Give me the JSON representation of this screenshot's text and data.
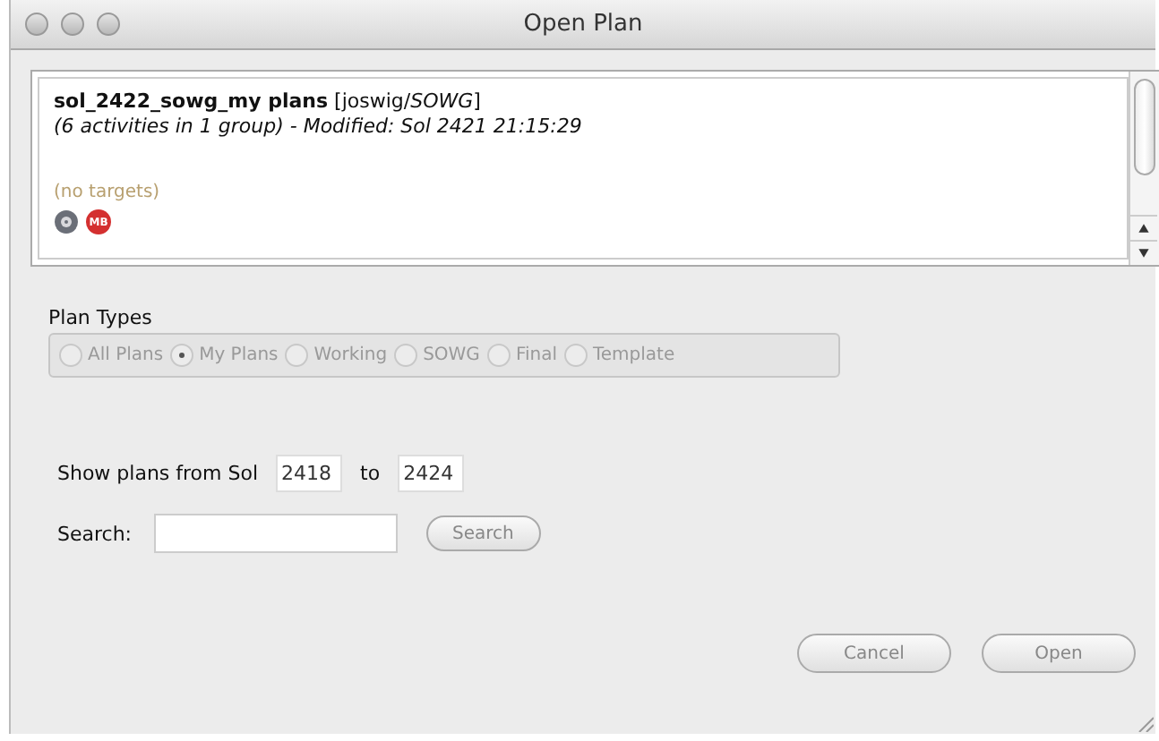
{
  "window": {
    "title": "Open Plan"
  },
  "plans": [
    {
      "name": "sol_2422_sowg_my plans",
      "owner": "[joswig/*SOWG*]",
      "details": "(6 activities in 1 group) - Modified: Sol 2421 21:15:29",
      "targets": "(no targets)",
      "badge": "MB",
      "selected": false
    }
  ],
  "plan_types": {
    "label": "Plan Types",
    "disabled": true,
    "options": [
      {
        "label": "All Plans",
        "selected": false
      },
      {
        "label": "My Plans",
        "selected": true
      },
      {
        "label": "Working",
        "selected": false
      },
      {
        "label": "SOWG",
        "selected": false
      },
      {
        "label": "Final",
        "selected": false
      },
      {
        "label": "Template",
        "selected": false
      }
    ]
  },
  "sol_range": {
    "label": "Show plans from Sol",
    "from": "2418",
    "separator": "to",
    "to": "2424"
  },
  "search": {
    "label": "Search:",
    "button": "Search",
    "disabled": true
  },
  "buttons": [
    {
      "label": "Cancel",
      "disabled": true
    },
    {
      "label": "Open",
      "disabled": true
    }
  ]
}
